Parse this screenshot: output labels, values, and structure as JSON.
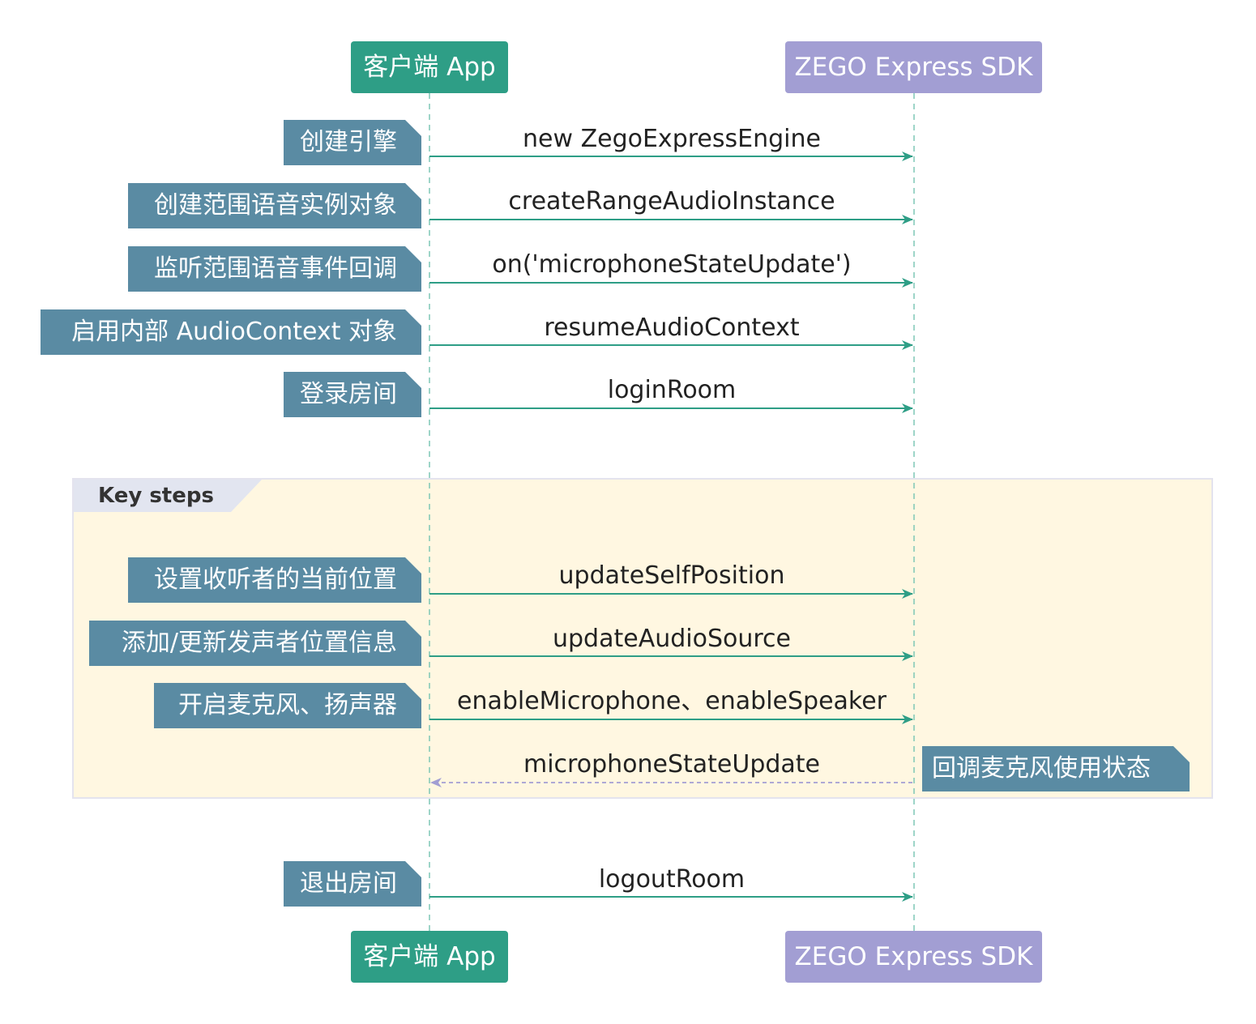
{
  "participants": {
    "app": "客户端 App",
    "sdk": "ZEGO Express SDK"
  },
  "group": {
    "label": "Key steps"
  },
  "steps": [
    {
      "note": "创建引擎",
      "message": "new ZegoExpressEngine",
      "direction": "app-to-sdk",
      "style": "solid"
    },
    {
      "note": "创建范围语音实例对象",
      "message": "createRangeAudioInstance",
      "direction": "app-to-sdk",
      "style": "solid"
    },
    {
      "note": "监听范围语音事件回调",
      "message": "on('microphoneStateUpdate')",
      "direction": "app-to-sdk",
      "style": "solid"
    },
    {
      "note": "启用内部 AudioContext 对象",
      "message": "resumeAudioContext",
      "direction": "app-to-sdk",
      "style": "solid"
    },
    {
      "note": "登录房间",
      "message": "loginRoom",
      "direction": "app-to-sdk",
      "style": "solid"
    },
    {
      "note": "设置收听者的当前位置",
      "message": "updateSelfPosition",
      "direction": "app-to-sdk",
      "style": "solid"
    },
    {
      "note": "添加/更新发声者位置信息",
      "message": "updateAudioSource",
      "direction": "app-to-sdk",
      "style": "solid"
    },
    {
      "note": "开启麦克风、扬声器",
      "message": "enableMicrophone、enableSpeaker",
      "direction": "app-to-sdk",
      "style": "solid"
    },
    {
      "note": "回调麦克风使用状态",
      "message": "microphoneStateUpdate",
      "direction": "sdk-to-app",
      "style": "dashed"
    },
    {
      "note": "退出房间",
      "message": "logoutRoom",
      "direction": "app-to-sdk",
      "style": "solid"
    }
  ],
  "colors": {
    "app": "#2e9e86",
    "sdk": "#a29ed3",
    "note": "#5a8ba3",
    "arrow": "#2e9e86",
    "return_arrow": "#a29ed3",
    "group_bg": "#fff7e1",
    "group_tab": "#e2e5f0"
  }
}
